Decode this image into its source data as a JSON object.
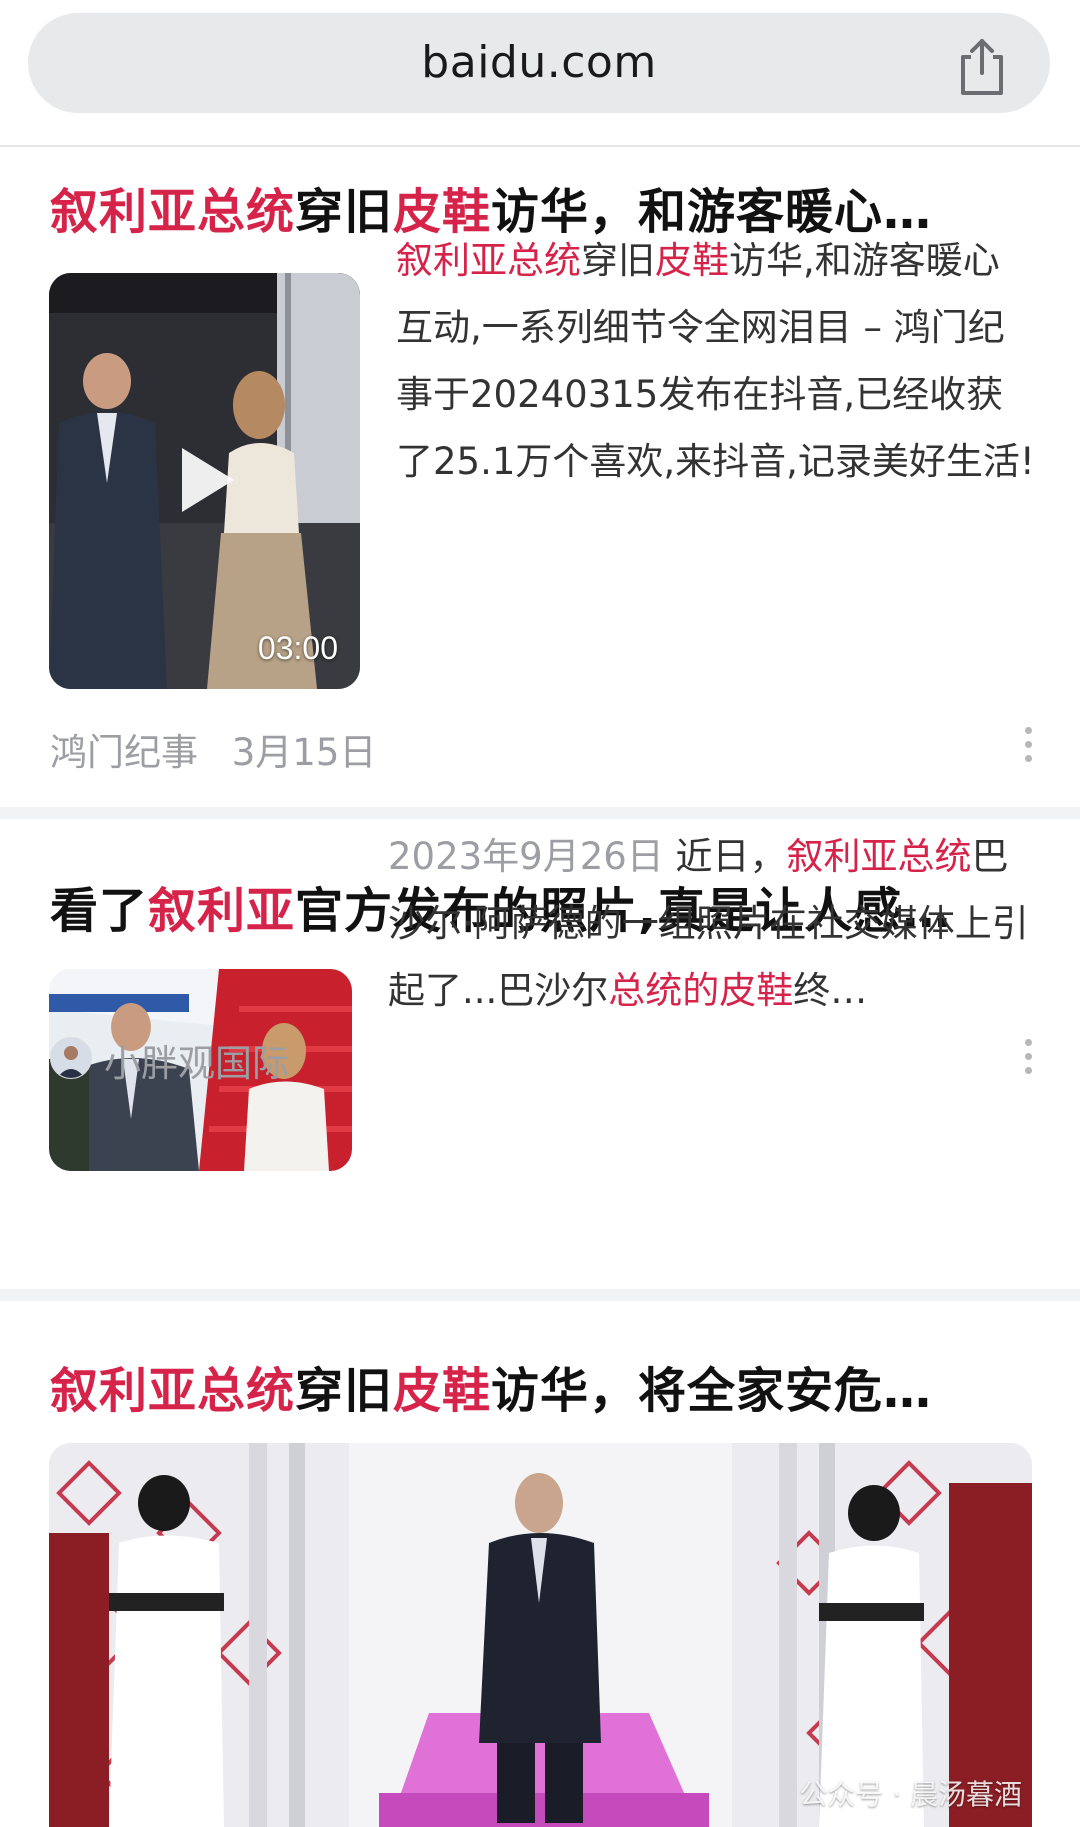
{
  "browser": {
    "url": "baidu.com"
  },
  "results": [
    {
      "title_parts": [
        {
          "text": "叙利亚总统",
          "hl": true
        },
        {
          "text": "穿旧",
          "hl": false
        },
        {
          "text": "皮鞋",
          "hl": true
        },
        {
          "text": "访华，和游客暖心…",
          "hl": false
        }
      ],
      "snippet_parts": [
        {
          "text": "叙利亚总统",
          "hl": true
        },
        {
          "text": "穿旧",
          "hl": false
        },
        {
          "text": "皮鞋",
          "hl": true
        },
        {
          "text": "访华,和游客暖心互动,一系列细节令全网泪目 – 鸿门纪事于20240315发布在抖音,已经收获了25.1万个喜欢,来抖音,记录美好生活!",
          "hl": false
        }
      ],
      "video_duration": "03:00",
      "source": "鸿门纪事",
      "date": "3月15日"
    },
    {
      "title_parts": [
        {
          "text": "看了",
          "hl": false
        },
        {
          "text": "叙利亚",
          "hl": true
        },
        {
          "text": "官方发布的照片,真是让人感…",
          "hl": false
        }
      ],
      "snippet_parts": [
        {
          "text": "2023年9月26日  ",
          "hl": false,
          "muted": true
        },
        {
          "text": "近日，",
          "hl": false
        },
        {
          "text": "叙利亚总统",
          "hl": true
        },
        {
          "text": "巴沙尔·阿萨德的一组照片在社交媒体上引起了...巴沙尔",
          "hl": false
        },
        {
          "text": "总统的皮鞋",
          "hl": true
        },
        {
          "text": "终…",
          "hl": false
        }
      ],
      "source": "小胖观国际"
    },
    {
      "title_parts": [
        {
          "text": "叙利亚总统",
          "hl": true
        },
        {
          "text": "穿旧",
          "hl": false
        },
        {
          "text": "皮鞋",
          "hl": true
        },
        {
          "text": "访华，将全家安危…",
          "hl": false
        }
      ],
      "watermark": "公众号 · 晨汤暮酒"
    }
  ],
  "colors": {
    "highlight": "#d6234a",
    "muted": "#9c9ea3",
    "separator": "#f2f3f5"
  }
}
